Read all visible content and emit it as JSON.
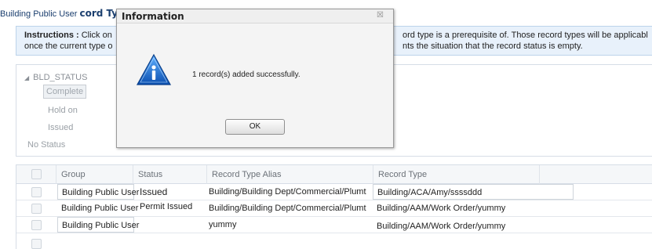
{
  "page": {
    "title_prefix": "Building Public User",
    "title_suffix": "cord Ty"
  },
  "instructions": {
    "label": "Instructions :",
    "line1_left": " Click on",
    "line2_left": "once the current type o",
    "line1_right": "ord type is a prerequisite of. Those record types will be applicabl",
    "line2_right": "nts the situation that the record status is empty."
  },
  "status_tree": {
    "root": "BLD_STATUS",
    "items": [
      "Complete",
      "Hold on",
      "Issued"
    ],
    "no_status": "No Status"
  },
  "grid": {
    "headers": [
      "Group",
      "Status",
      "Record Type Alias",
      "Record Type"
    ],
    "rows": [
      {
        "group": "Building Public User",
        "status": "Issued",
        "alias": "Building/Building Dept/Commercial/Plumt",
        "type": "Building/ACA/Amy/ssssddd"
      },
      {
        "group": "Building Public User",
        "status": "Permit Issued",
        "alias": "Building/Building Dept/Commercial/Plumt",
        "type": "Building/AAM/Work Order/yummy"
      },
      {
        "group": "Building Public User",
        "status": "",
        "alias": "yummy",
        "type": "Building/AAM/Work Order/yummy"
      }
    ]
  },
  "dialog": {
    "title": "Information",
    "close_glyph": "☒",
    "message": "1 record(s) added successfully.",
    "ok_label": "OK",
    "icon": "info-icon",
    "accent": "#1f6fc9"
  }
}
